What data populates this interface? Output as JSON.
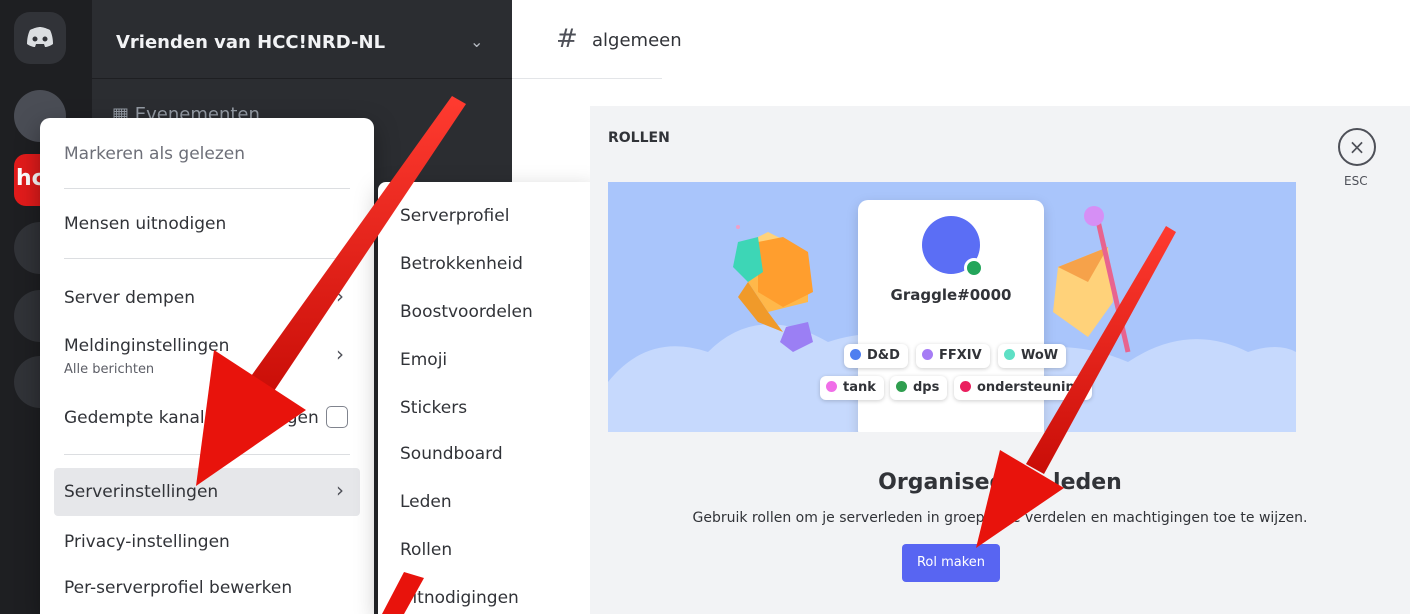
{
  "server": {
    "name": "Vrienden van HCC!NRD-NL",
    "events_label": "Evenementen",
    "guild_label": "hc"
  },
  "channel": {
    "name": "algemeen"
  },
  "context_menu": {
    "items": [
      {
        "label": "Markeren als gelezen",
        "muted": true
      },
      {
        "label": "Mensen uitnodigen"
      },
      {
        "label": "Server dempen"
      },
      {
        "label": "Meldinginstellingen",
        "sub": "Alle berichten"
      },
      {
        "label": "Gedempte kanalen verbergen"
      },
      {
        "label": "Serverinstellingen"
      },
      {
        "label": "Privacy-instellingen"
      },
      {
        "label": "Per-serverprofiel bewerken"
      }
    ]
  },
  "submenu": {
    "items": [
      "Serverprofiel",
      "Betrokkenheid",
      "Boostvoordelen",
      "Emoji",
      "Stickers",
      "Soundboard",
      "Leden",
      "Rollen",
      "Uitnodigingen"
    ]
  },
  "roles_panel": {
    "title": "ROLLEN",
    "close_label": "ESC",
    "preview_user": "Graggle#0000",
    "tags": [
      {
        "name": "D&D",
        "color": "#4f7ff0"
      },
      {
        "name": "FFXIV",
        "color": "#a67cf5"
      },
      {
        "name": "WoW",
        "color": "#5ee0c5"
      },
      {
        "name": "tank",
        "color": "#f06ee8"
      },
      {
        "name": "dps",
        "color": "#2f9e4f"
      },
      {
        "name": "ondersteuning",
        "color": "#ea1f5e"
      }
    ],
    "heading": "Organiseer je leden",
    "description": "Gebruik rollen om je serverleden in groepen te verdelen en machtigingen toe te wijzen.",
    "button_label": "Rol maken"
  },
  "colors": {
    "accent": "#5865f2",
    "annotation_arrow": "#e8130c"
  }
}
